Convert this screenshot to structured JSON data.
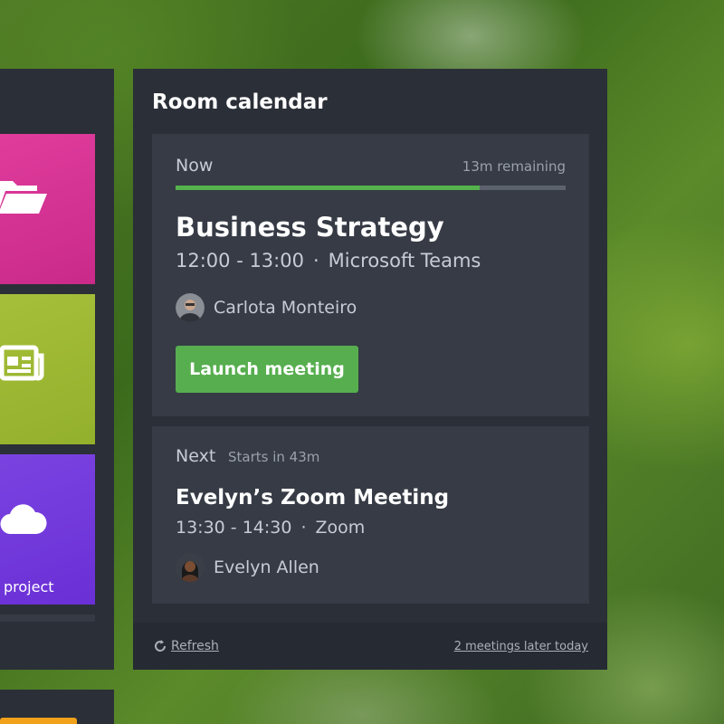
{
  "tiles": [
    {
      "icon": "folder-icon",
      "color": "#e03c9c",
      "label": ""
    },
    {
      "icon": "newspaper-icon",
      "color": "#a6bf3a",
      "label": ""
    },
    {
      "icon": "cloud-icon",
      "color": "#7a43e0",
      "label": "project"
    }
  ],
  "calendar": {
    "title": "Room calendar",
    "now": {
      "label": "Now",
      "remaining": "13m remaining",
      "progress": 0.78,
      "title": "Business Strategy",
      "time": "12:00 - 13:00",
      "separator": "·",
      "platform": "Microsoft Teams",
      "organizer": "Carlota Monteiro",
      "launch_label": "Launch meeting"
    },
    "next": {
      "label": "Next",
      "starts_in": "Starts in 43m",
      "title": "Evelyn’s Zoom Meeting",
      "time": "13:30 - 14:30",
      "separator": "·",
      "platform": "Zoom",
      "organizer": "Evelyn Allen"
    },
    "footer": {
      "refresh_label": "Refresh",
      "later_label": "2 meetings later today"
    }
  },
  "colors": {
    "accent_green": "#57ae4f",
    "panel": "#2b2f37",
    "card": "#363b45"
  }
}
